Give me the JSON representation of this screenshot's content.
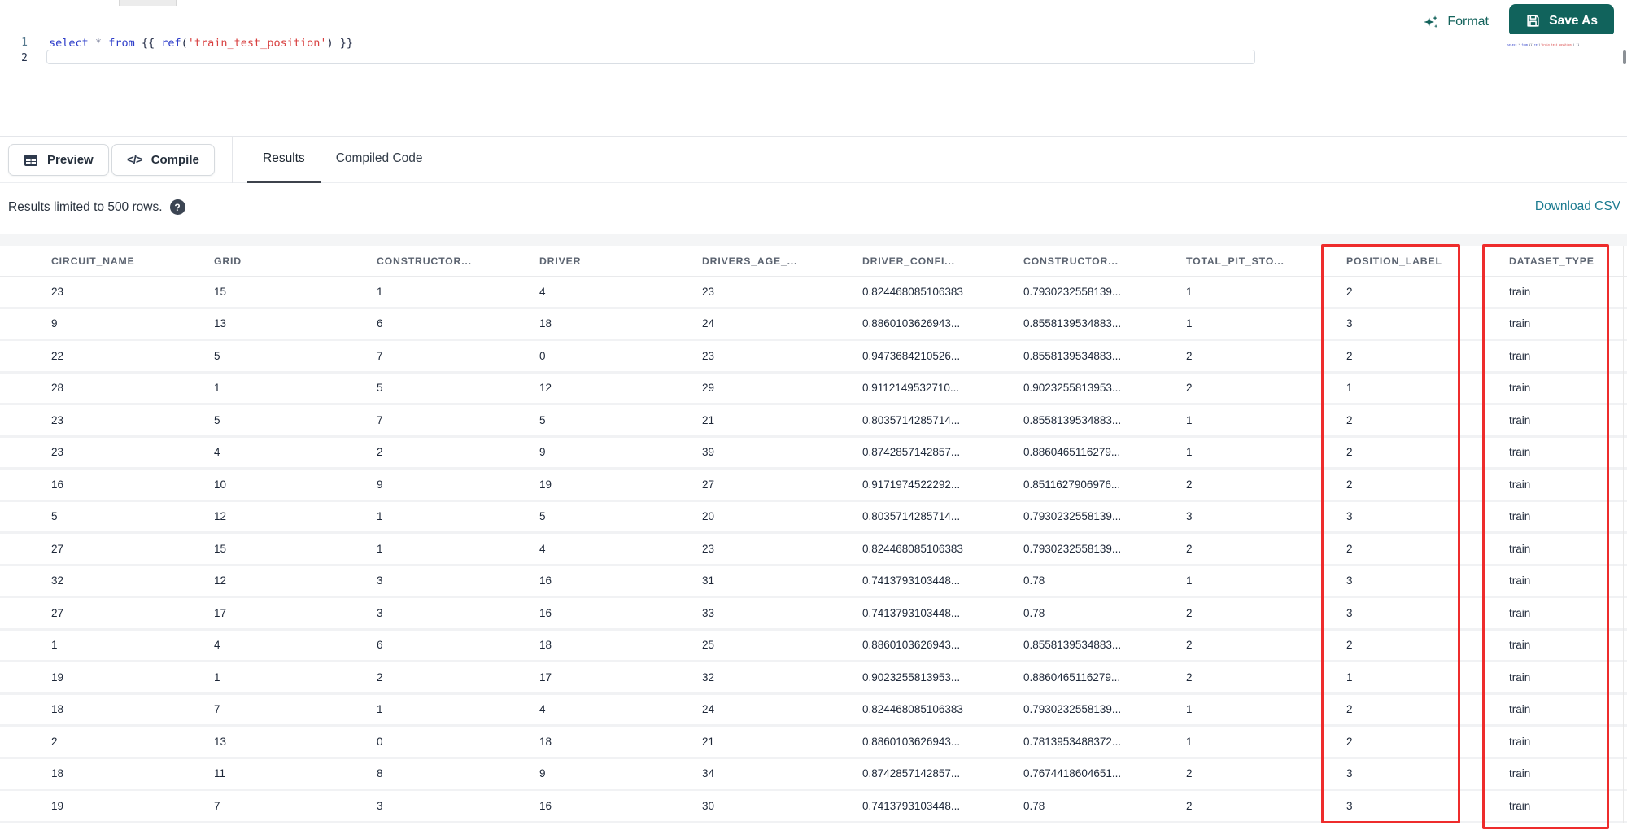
{
  "toolbar": {
    "format": "Format",
    "save_as": "Save As"
  },
  "editor": {
    "line_numbers": [
      "1",
      "2"
    ],
    "code": "select * from {{ ref('train_test_position') }}",
    "tokens": [
      {
        "text": "select",
        "type": "kw"
      },
      {
        "text": " ",
        "type": "pl"
      },
      {
        "text": "*",
        "type": "op"
      },
      {
        "text": " ",
        "type": "pl"
      },
      {
        "text": "from",
        "type": "kw"
      },
      {
        "text": " ",
        "type": "pl"
      },
      {
        "text": "{{ ",
        "type": "pl"
      },
      {
        "text": "ref",
        "type": "fn"
      },
      {
        "text": "(",
        "type": "pl"
      },
      {
        "text": "'train_test_position'",
        "type": "str"
      },
      {
        "text": ")",
        "type": "pl"
      },
      {
        "text": " }}",
        "type": "pl"
      }
    ]
  },
  "action_bar": {
    "preview": "Preview",
    "compile": "Compile",
    "tabs": [
      {
        "label": "Results",
        "active": true
      },
      {
        "label": "Compiled Code",
        "active": false
      }
    ]
  },
  "results_bar": {
    "info": "Results limited to 500 rows.",
    "download": "Download CSV"
  },
  "table": {
    "columns": [
      "CIRCUIT_NAME",
      "GRID",
      "CONSTRUCTOR...",
      "DRIVER",
      "DRIVERS_AGE_...",
      "DRIVER_CONFI...",
      "CONSTRUCTOR...",
      "TOTAL_PIT_STO...",
      "POSITION_LABEL",
      "DATASET_TYPE"
    ],
    "rows": [
      [
        "23",
        "15",
        "1",
        "4",
        "23",
        "0.824468085106383",
        "0.7930232558139...",
        "1",
        "2",
        "train"
      ],
      [
        "9",
        "13",
        "6",
        "18",
        "24",
        "0.8860103626943...",
        "0.8558139534883...",
        "1",
        "3",
        "train"
      ],
      [
        "22",
        "5",
        "7",
        "0",
        "23",
        "0.9473684210526...",
        "0.8558139534883...",
        "2",
        "2",
        "train"
      ],
      [
        "28",
        "1",
        "5",
        "12",
        "29",
        "0.9112149532710...",
        "0.9023255813953...",
        "2",
        "1",
        "train"
      ],
      [
        "23",
        "5",
        "7",
        "5",
        "21",
        "0.8035714285714...",
        "0.8558139534883...",
        "1",
        "2",
        "train"
      ],
      [
        "23",
        "4",
        "2",
        "9",
        "39",
        "0.8742857142857...",
        "0.8860465116279...",
        "1",
        "2",
        "train"
      ],
      [
        "16",
        "10",
        "9",
        "19",
        "27",
        "0.9171974522292...",
        "0.8511627906976...",
        "2",
        "2",
        "train"
      ],
      [
        "5",
        "12",
        "1",
        "5",
        "20",
        "0.8035714285714...",
        "0.7930232558139...",
        "3",
        "3",
        "train"
      ],
      [
        "27",
        "15",
        "1",
        "4",
        "23",
        "0.824468085106383",
        "0.7930232558139...",
        "2",
        "2",
        "train"
      ],
      [
        "32",
        "12",
        "3",
        "16",
        "31",
        "0.7413793103448...",
        "0.78",
        "1",
        "3",
        "train"
      ],
      [
        "27",
        "17",
        "3",
        "16",
        "33",
        "0.7413793103448...",
        "0.78",
        "2",
        "3",
        "train"
      ],
      [
        "1",
        "4",
        "6",
        "18",
        "25",
        "0.8860103626943...",
        "0.8558139534883...",
        "2",
        "2",
        "train"
      ],
      [
        "19",
        "1",
        "2",
        "17",
        "32",
        "0.9023255813953...",
        "0.8860465116279...",
        "2",
        "1",
        "train"
      ],
      [
        "18",
        "7",
        "1",
        "4",
        "24",
        "0.824468085106383",
        "0.7930232558139...",
        "1",
        "2",
        "train"
      ],
      [
        "2",
        "13",
        "0",
        "18",
        "21",
        "0.8860103626943...",
        "0.7813953488372...",
        "1",
        "2",
        "train"
      ],
      [
        "18",
        "11",
        "8",
        "9",
        "34",
        "0.8742857142857...",
        "0.7674418604651...",
        "2",
        "3",
        "train"
      ],
      [
        "19",
        "7",
        "3",
        "16",
        "30",
        "0.7413793103448...",
        "0.78",
        "2",
        "3",
        "train"
      ]
    ]
  },
  "annotations": {
    "color": "#ee2c2c",
    "boxes": [
      {
        "column": "POSITION_LABEL"
      },
      {
        "column": "DATASET_TYPE"
      }
    ]
  },
  "colors": {
    "accent_teal": "#11635c",
    "download_link": "#1c7b90",
    "annotation_red": "#ee2c2c",
    "keyword_blue": "#2c3cc9",
    "string_red": "#d84040"
  }
}
